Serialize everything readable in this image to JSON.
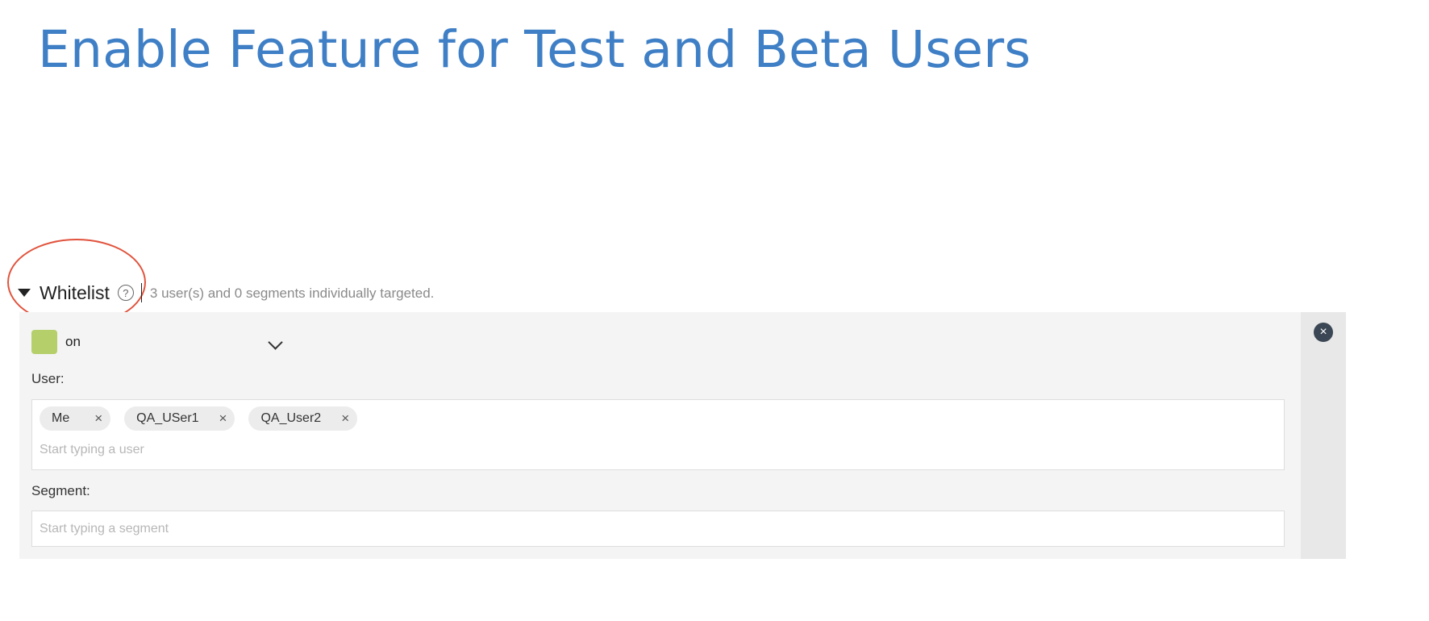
{
  "slide": {
    "title": "Enable Feature for Test and Beta Users"
  },
  "whitelist": {
    "label": "Whitelist",
    "help_glyph": "?",
    "summary": "3 user(s) and 0 segments individually targeted.",
    "annotation_color": "#e1533d",
    "variation": {
      "value": "on",
      "color": "#b5cf6b"
    },
    "remove_glyph": "×",
    "user_label": "User:",
    "users": [
      {
        "name": "Me",
        "remove_glyph": "×"
      },
      {
        "name": "QA_USer1",
        "remove_glyph": "×"
      },
      {
        "name": "QA_User2",
        "remove_glyph": "×"
      }
    ],
    "user_placeholder": "Start typing a user",
    "segment_label": "Segment:",
    "segment_placeholder": "Start typing a segment"
  },
  "colors": {
    "title": "#3f7fc6",
    "panel_background": "#f4f4f4",
    "panel_sidebar": "#e8e8e8",
    "remove_button": "#3b4754",
    "tag_background": "#ececec"
  },
  "icons": {
    "section_toggle": "caret-down-icon",
    "help": "question-circle-icon",
    "dropdown": "chevron-down-icon",
    "remove_rule": "close-circle-icon",
    "remove_tag": "close-icon"
  }
}
